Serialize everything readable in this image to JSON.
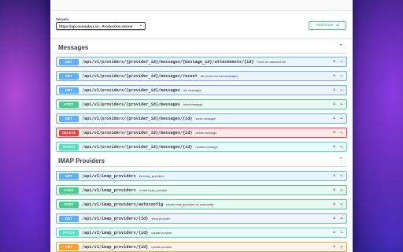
{
  "servers": {
    "label": "Servers",
    "selected": "https://api.sunnybox.io - Production server"
  },
  "authorize": {
    "label": "Authorize"
  },
  "sections": [
    {
      "title": "Messages",
      "operations": [
        {
          "method": "GET",
          "path": "/api/v1/providers/{provider_id}/messages/{message_id}/attachments/{id}",
          "summary": "Fetch an attached file"
        },
        {
          "method": "GET",
          "path": "/api/v1/providers/{provider_id}/messages/recent",
          "summary": "list recent unread messages"
        },
        {
          "method": "GET",
          "path": "/api/v1/providers/{provider_id}/messages",
          "summary": "list messages"
        },
        {
          "method": "POST",
          "path": "/api/v1/providers/{provider_id}/messages",
          "summary": "send message"
        },
        {
          "method": "GET",
          "path": "/api/v1/providers/{provider_id}/messages/{id}",
          "summary": "show message"
        },
        {
          "method": "DELETE",
          "path": "/api/v1/providers/{provider_id}/messages/{id}",
          "summary": "delete message"
        },
        {
          "method": "PATCH",
          "path": "/api/v1/providers/{provider_id}/messages/{id}",
          "summary": "update message"
        }
      ]
    },
    {
      "title": "IMAP Providers",
      "operations": [
        {
          "method": "GET",
          "path": "/api/v1/imap_providers",
          "summary": "list imap_providers"
        },
        {
          "method": "POST",
          "path": "/api/v1/imap_providers",
          "summary": "create imap_provider"
        },
        {
          "method": "POST",
          "path": "/api/v1/imap_providers/autoconfig",
          "summary": "create imap_provider via autoconfig"
        },
        {
          "method": "GET",
          "path": "/api/v1/imap_providers/{id}",
          "summary": "show provider"
        },
        {
          "method": "PATCH",
          "path": "/api/v1/imap_providers/{id}",
          "summary": "update provider"
        },
        {
          "method": "PUT",
          "path": "/api/v1/imap_providers/{id}",
          "summary": "update provider"
        }
      ]
    }
  ],
  "colors": {
    "get": "#61affe",
    "post": "#49cc90",
    "delete": "#f93e3e",
    "patch": "#50e3c2",
    "put": "#fca130"
  },
  "icons": {
    "lock": "lock-icon",
    "expand": "chevron-down-icon",
    "collapse": "chevron-up-icon"
  }
}
